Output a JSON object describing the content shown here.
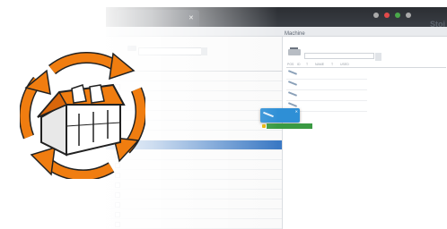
{
  "window": {
    "tab_title": "",
    "brand_text": "Stoi"
  },
  "left_pane": {
    "machine_label": "",
    "columns": [
      "",
      "",
      "",
      "",
      "",
      ""
    ],
    "rows": [
      {
        "name": "",
        "a": "",
        "b": "",
        "c": ""
      },
      {
        "name": "",
        "a": "",
        "b": "",
        "c": ""
      },
      {
        "name": "",
        "a": "",
        "b": "",
        "c": ""
      },
      {
        "name": "",
        "a": "",
        "b": "",
        "c": ""
      },
      {
        "name": "",
        "a": "",
        "b": "",
        "c": ""
      },
      {
        "name": "",
        "a": "",
        "b": "",
        "c": ""
      },
      {
        "name": "",
        "a": "",
        "b": "",
        "c": ""
      },
      {
        "name": "",
        "a": "",
        "b": "",
        "c": ""
      },
      {
        "name": "",
        "a": "",
        "b": "",
        "c": ""
      },
      {
        "name": "",
        "a": "",
        "b": "",
        "c": ""
      },
      {
        "name": "",
        "a": "",
        "b": "",
        "c": ""
      },
      {
        "name": "",
        "a": "",
        "b": "",
        "c": ""
      },
      {
        "name": "",
        "a": "",
        "b": "",
        "c": ""
      },
      {
        "name": "",
        "a": "",
        "b": "",
        "c": ""
      },
      {
        "name": "",
        "a": "",
        "b": "",
        "c": ""
      },
      {
        "name": "",
        "a": "",
        "b": "",
        "c": ""
      },
      {
        "name": "",
        "a": "",
        "b": "",
        "c": ""
      }
    ],
    "selected_index": 7
  },
  "right_pane": {
    "title": "Machine",
    "machine_label": "",
    "combo_value": "",
    "columns": [
      "POS",
      "ID",
      "T",
      "NAME",
      "T",
      "USED"
    ],
    "items": [
      {
        "name": "",
        "value": ""
      },
      {
        "name": "",
        "value": ""
      },
      {
        "name": "",
        "value": ""
      },
      {
        "name": "",
        "value": ""
      }
    ]
  },
  "drag_card": {
    "title": "",
    "subtitle": ""
  },
  "hint_text": "",
  "colors": {
    "accent_orange": "#f07d10",
    "selection_blue": "#3b79c4",
    "card_blue": "#2e8fd6",
    "hint_green": "#3a9a43"
  },
  "icons": [
    "refresh-cycle-logo-icon",
    "close-icon",
    "machine-icon",
    "tool-icon"
  ]
}
